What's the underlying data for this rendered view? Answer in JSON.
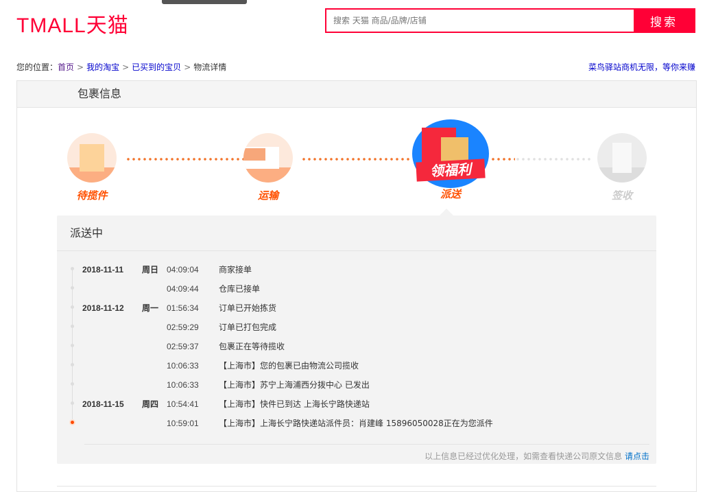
{
  "header": {
    "logo": "TMALL天猫",
    "search_placeholder": "搜索 天猫 商品/品牌/店铺",
    "search_button": "搜索"
  },
  "breadcrumb": {
    "prefix": "您的位置：",
    "items": [
      "首页",
      "我的淘宝",
      "已买到的宝贝"
    ],
    "current": "物流详情",
    "sep": ">"
  },
  "promo_link": "菜鸟驿站商机无限，等你来赚",
  "panel": {
    "title": "包裹信息"
  },
  "steps": [
    {
      "label": "待揽件",
      "state": "done"
    },
    {
      "label": "运输",
      "state": "done"
    },
    {
      "label": "派送",
      "state": "active",
      "badge": "领福利"
    },
    {
      "label": "签收",
      "state": "pending"
    }
  ],
  "detail": {
    "status": "派送中",
    "events": [
      {
        "date": "2018-11-11",
        "weekday": "周日",
        "time": "04:09:04",
        "text": "商家接单"
      },
      {
        "date": "",
        "weekday": "",
        "time": "04:09:44",
        "text": "仓库已接单"
      },
      {
        "date": "2018-11-12",
        "weekday": "周一",
        "time": "01:56:34",
        "text": "订单已开始拣货"
      },
      {
        "date": "",
        "weekday": "",
        "time": "02:59:29",
        "text": "订单已打包完成"
      },
      {
        "date": "",
        "weekday": "",
        "time": "02:59:37",
        "text": "包裹正在等待揽收"
      },
      {
        "date": "",
        "weekday": "",
        "time": "10:06:33",
        "text": "【上海市】您的包裹已由物流公司揽收"
      },
      {
        "date": "",
        "weekday": "",
        "time": "10:06:33",
        "text": "【上海市】苏宁上海浦西分拨中心 已发出"
      },
      {
        "date": "2018-11-15",
        "weekday": "周四",
        "time": "10:54:41",
        "text": "【上海市】快件已到达 上海长宁路快递站"
      },
      {
        "date": "",
        "weekday": "",
        "time": "10:59:01",
        "text": "【上海市】上海长宁路快递站派件员：肖建峰 15896050028正在为您派件"
      }
    ],
    "footer_note": "以上信息已经过优化处理，如需查看快递公司原文信息 ",
    "footer_link": "请点击"
  },
  "colors": {
    "brand": "#ff0036",
    "accent": "#ff5000",
    "link": "#0070c9"
  }
}
